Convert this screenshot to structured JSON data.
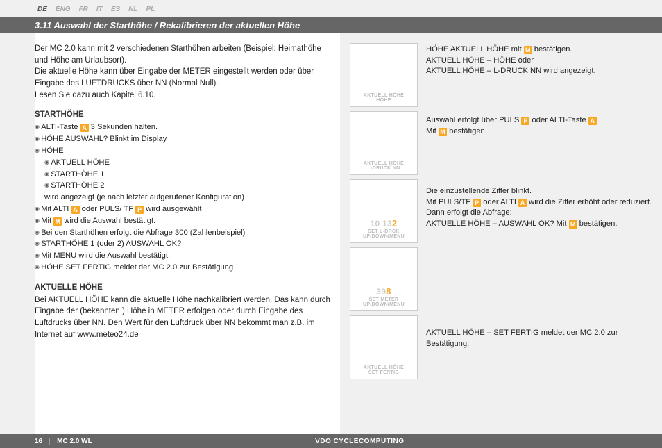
{
  "lang_bar": {
    "items": [
      "DE",
      "ENG",
      "FR",
      "IT",
      "ES",
      "NL",
      "PL"
    ],
    "active": 0
  },
  "title": "3.11 Auswahl der Starthöhe / Rekalibrieren der aktuellen Höhe",
  "intro": {
    "p1": "Der MC 2.0 kann mit 2 verschiedenen Starthöhen arbeiten (Beispiel: Heimathöhe und Höhe am Urlaubsort).",
    "p2": "Die aktuelle Höhe kann über Eingabe der METER eingestellt werden oder über Eingabe des LUFTDRUCKS über NN (Normal Null).",
    "p3": "Lesen Sie dazu auch Kapitel 6.10."
  },
  "keys": {
    "A": "A",
    "M": "M",
    "P": "P"
  },
  "section1": {
    "head": "STARTHÖHE",
    "items": [
      {
        "t": "ALTI-Taste ",
        "k": "A",
        "t2": "  3 Sekunden halten."
      },
      {
        "t": "HÖHE AUSWAHL? Blinkt im Display"
      },
      {
        "t": "HÖHE"
      },
      {
        "t": "AKTUELL HÖHE",
        "sub": true
      },
      {
        "t": "STARTHÖHE 1",
        "sub": true
      },
      {
        "t": "STARTHÖHE 2",
        "sub": true
      },
      {
        "t": "wird angezeigt (je nach letzter aufgerufener Konfiguration)",
        "sub": true,
        "nobul": true
      },
      {
        "t": "Mit ALTI ",
        "k": "A",
        "t2": " oder PULS/ TF ",
        "k2": "P",
        "t3": " wird ausgewählt"
      },
      {
        "t": "Mit ",
        "k": "M",
        "t2": " wird die Auswahl bestätigt."
      },
      {
        "t": "Bei den Starthöhen erfolgt die Abfrage 300 (Zahlenbeispiel)"
      },
      {
        "t": "STARTHÖHE 1 (oder 2) AUSWAHL OK?"
      },
      {
        "t": "Mit MENU wird die Auswahl bestätigt."
      },
      {
        "t": "HÖHE SET FERTIG meldet der MC 2.0 zur Bestätigung"
      }
    ]
  },
  "section2": {
    "head": "AKTUELLE HÖHE",
    "text": "Bei AKTUELL HÖHE kann die aktuelle Höhe nachkalibriert werden. Das kann durch Eingabe der (bekannten ) Höhe in METER erfolgen oder durch Eingabe des Luftdrucks über NN. Den Wert für den Luftdruck über NN bekommt man z.B. im Internet auf www.meteo24.de"
  },
  "right": {
    "n1a": "HÖHE AKTUELL HÖHE mit ",
    "n1b": " bestätigen.",
    "n1c": "AKTUELL HÖHE – HÖHE oder",
    "n1d": "AKTUELL HÖHE – L-DRUCK NN wird angezeigt.",
    "n2a": "Auswahl erfolgt über PULS ",
    "n2b": " oder ALTI-Taste ",
    "n2c": " .",
    "n2d": "Mit ",
    "n2e": " bestätigen.",
    "n3a": "Die einzustellende Ziffer blinkt.",
    "n3b": "Mit PULS/TF ",
    "n3c": " oder ALTI ",
    "n3d": " wird die Ziffer erhöht oder reduziert.",
    "n3e": "Dann erfolgt die Abfrage:",
    "n3f": "AKTUELLE HÖHE – AUSWAHL OK? Mit ",
    "n3g": " bestätigen.",
    "n5": "AKTUELL HÖHE – SET FERTIG meldet der MC 2.0 zur Bestätigung."
  },
  "screens": [
    {
      "l1": "",
      "l2": "AKTUELL HÖHE",
      "l3": "HÖHE"
    },
    {
      "l1": "",
      "l2": "AKTUELL HÖHE",
      "l3": "L-DRUCK NN"
    },
    {
      "l1": "10 132",
      "hi": "2",
      "l2": "SET L-DRCK",
      "l3": "UP/DOWN/MENU"
    },
    {
      "l1": "398",
      "hi": "8",
      "l2": "SET METER",
      "l3": "UP/DOWN/MENU"
    },
    {
      "l1": "",
      "l2": "AKTUELL HÖHE",
      "l3": "SET FERTIG"
    }
  ],
  "footer": {
    "page": "16",
    "model": "MC 2.0 WL",
    "brand": "VDO CYCLECOMPUTING"
  }
}
